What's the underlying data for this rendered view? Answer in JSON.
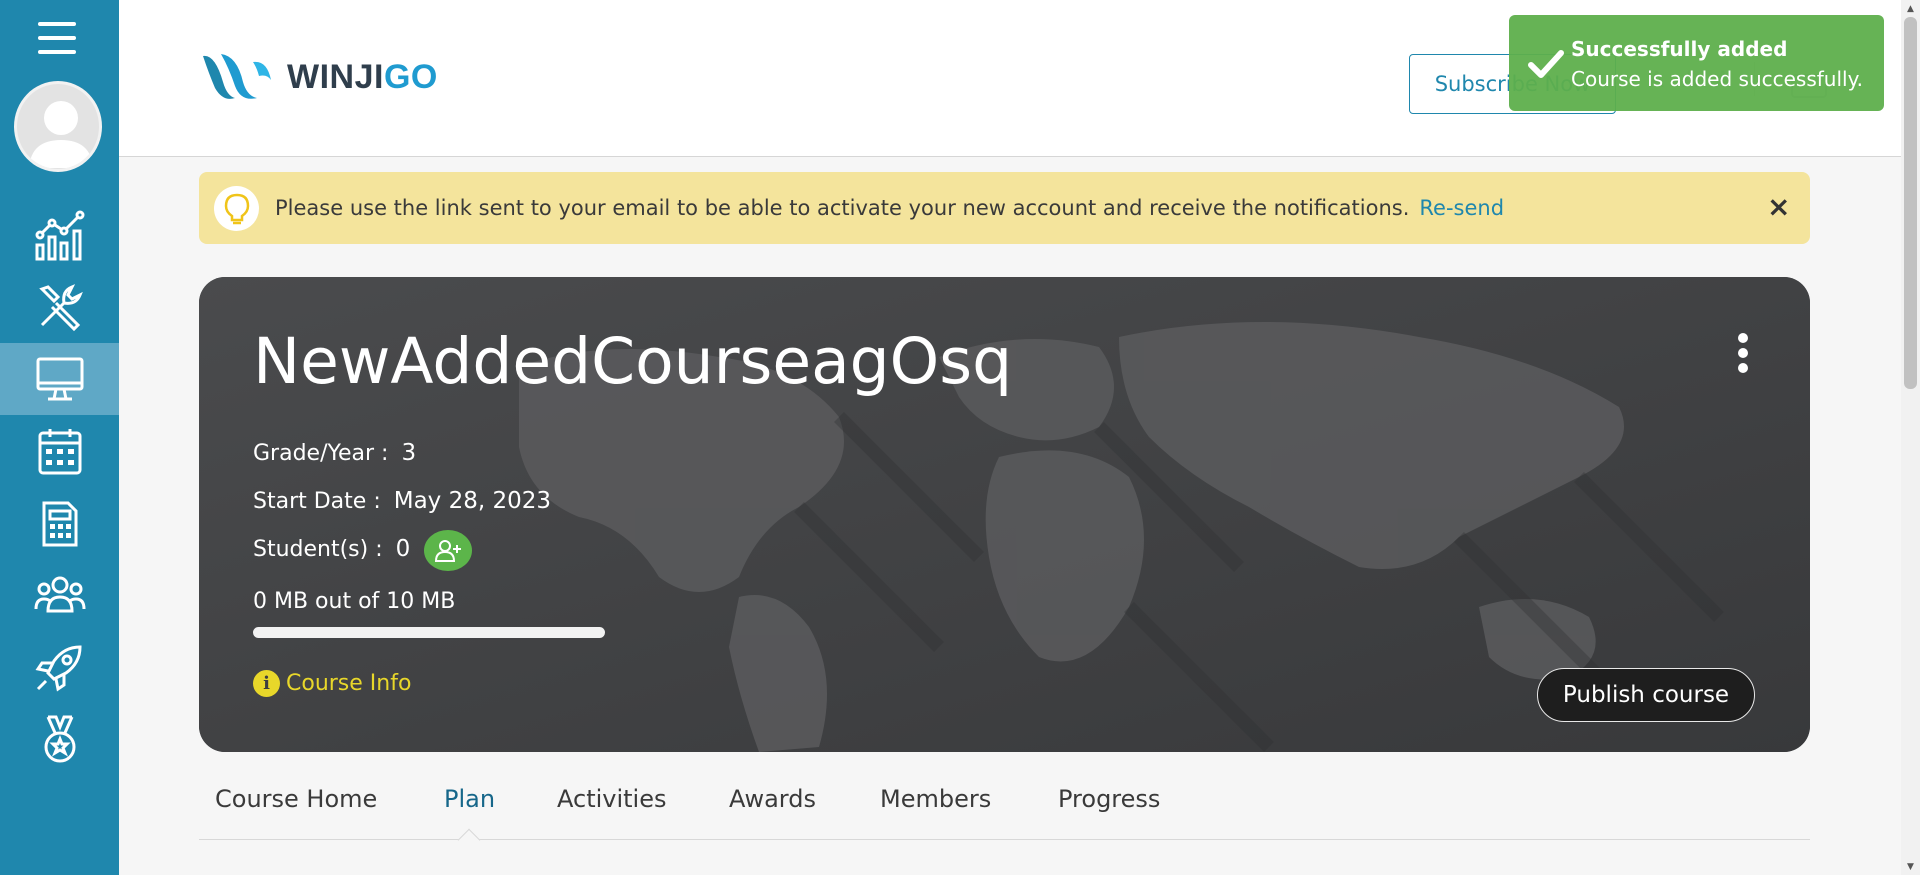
{
  "sidebar": {
    "items": [
      {
        "name": "analytics-icon"
      },
      {
        "name": "tools-icon"
      },
      {
        "name": "courses-icon",
        "active": true
      },
      {
        "name": "calendar-icon"
      },
      {
        "name": "calculator-icon"
      },
      {
        "name": "groups-icon"
      },
      {
        "name": "rocket-icon"
      },
      {
        "name": "medal-icon"
      }
    ],
    "bg_color": "#1f87ad",
    "active_color": "#5fa8c6"
  },
  "header": {
    "logo_part1": "WINJI",
    "logo_part2": "GO",
    "subscribe_label": "Subscribe Now",
    "font_icons": [
      "A",
      "A",
      "A"
    ]
  },
  "toast": {
    "title": "Successfully added",
    "message": "Course is added successfully.",
    "color": "#5eaf4c"
  },
  "notice": {
    "text": "Please use the link sent to your email to be able to activate your new account and receive the notifications.",
    "link": "Re-send",
    "close": "×",
    "bg_color": "#f4e49c"
  },
  "course": {
    "title": "NewAddedCourseagOsq",
    "grade_label": "Grade/Year :",
    "grade_value": "3",
    "start_label": "Start Date :",
    "start_value": "May 28, 2023",
    "students_label": "Student(s) :",
    "students_value": "0",
    "storage_text": "0 MB out of 10 MB",
    "storage_used_fraction": 0,
    "info_label": "Course Info",
    "info_icon": "i",
    "publish_label": "Publish course"
  },
  "tabs": [
    {
      "label": "Course Home"
    },
    {
      "label": "Plan",
      "active": true
    },
    {
      "label": "Activities"
    },
    {
      "label": "Awards"
    },
    {
      "label": "Members"
    },
    {
      "label": "Progress"
    }
  ]
}
